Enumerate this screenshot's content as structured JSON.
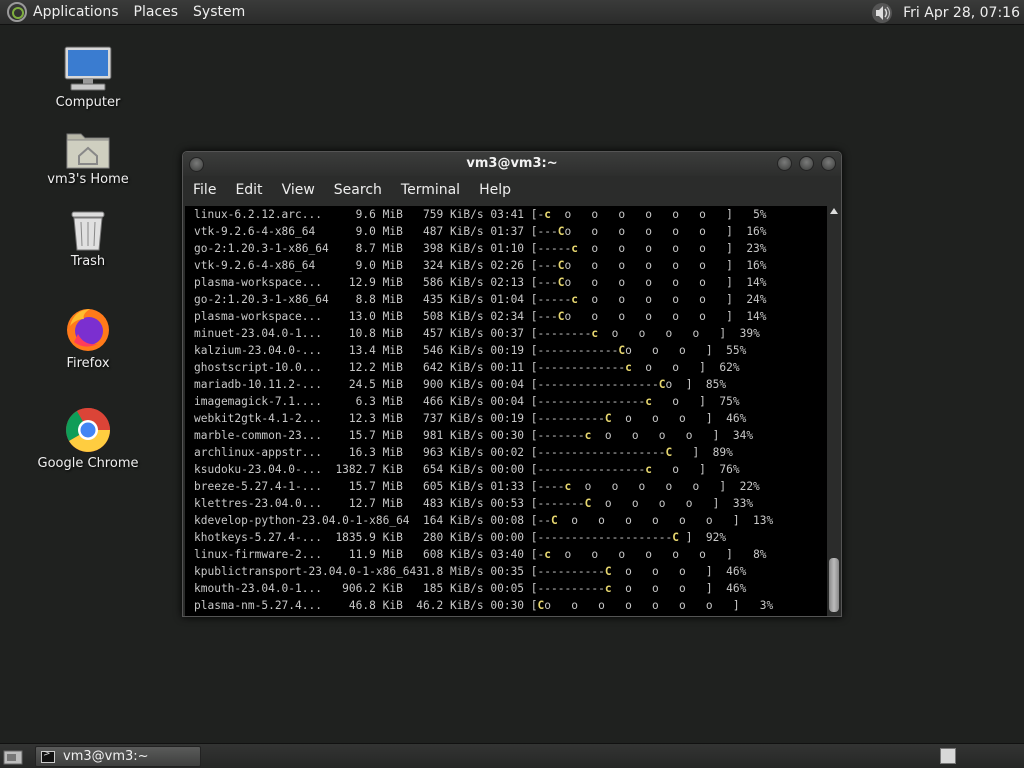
{
  "top_panel": {
    "menus": [
      "Applications",
      "Places",
      "System"
    ],
    "clock": "Fri Apr 28, 07:16"
  },
  "desktop_icons": [
    {
      "label": "Computer"
    },
    {
      "label": "vm3's Home"
    },
    {
      "label": "Trash"
    },
    {
      "label": "Firefox"
    },
    {
      "label": "Google Chrome"
    }
  ],
  "window": {
    "title": "vm3@vm3:~",
    "menu": [
      "File",
      "Edit",
      "View",
      "Search",
      "Terminal",
      "Help"
    ],
    "lines": [
      {
        "pre": "linux-6.2.12.arc...     9.6 MiB   759 KiB/s 03:41 [-",
        "pac": "c",
        "post": "  o   o   o   o   o   o   ]   5%"
      },
      {
        "pre": "vtk-9.2.6-4-x86_64      9.0 MiB   487 KiB/s 01:37 [---",
        "pac": "C",
        "post": "o   o   o   o   o   o   ]  16%"
      },
      {
        "pre": "go-2:1.20.3-1-x86_64    8.7 MiB   398 KiB/s 01:10 [-----",
        "pac": "c",
        "post": "  o   o   o   o   o   ]  23%"
      },
      {
        "pre": "vtk-9.2.6-4-x86_64      9.0 MiB   324 KiB/s 02:26 [---",
        "pac": "C",
        "post": "o   o   o   o   o   o   ]  16%"
      },
      {
        "pre": "plasma-workspace...    12.9 MiB   586 KiB/s 02:13 [---",
        "pac": "C",
        "post": "o   o   o   o   o   o   ]  14%"
      },
      {
        "pre": "go-2:1.20.3-1-x86_64    8.8 MiB   435 KiB/s 01:04 [-----",
        "pac": "c",
        "post": "  o   o   o   o   o   ]  24%"
      },
      {
        "pre": "plasma-workspace...    13.0 MiB   508 KiB/s 02:34 [---",
        "pac": "C",
        "post": "o   o   o   o   o   o   ]  14%"
      },
      {
        "pre": "minuet-23.04.0-1...    10.8 MiB   457 KiB/s 00:37 [--------",
        "pac": "c",
        "post": "  o   o   o   o   ]  39%"
      },
      {
        "pre": "kalzium-23.04.0-...    13.4 MiB   546 KiB/s 00:19 [------------",
        "pac": "C",
        "post": "o   o   o   ]  55%"
      },
      {
        "pre": "ghostscript-10.0...    12.2 MiB   642 KiB/s 00:11 [-------------",
        "pac": "c",
        "post": "  o   o   ]  62%"
      },
      {
        "pre": "mariadb-10.11.2-...    24.5 MiB   900 KiB/s 00:04 [------------------",
        "pac": "C",
        "post": "o  ]  85%"
      },
      {
        "pre": "imagemagick-7.1....     6.3 MiB   466 KiB/s 00:04 [----------------",
        "pac": "c",
        "post": "   o   ]  75%"
      },
      {
        "pre": "webkit2gtk-4.1-2...    12.3 MiB   737 KiB/s 00:19 [----------",
        "pac": "C",
        "post": "  o   o   o   ]  46%"
      },
      {
        "pre": "marble-common-23...    15.7 MiB   981 KiB/s 00:30 [-------",
        "pac": "c",
        "post": "  o   o   o   o   ]  34%"
      },
      {
        "pre": "archlinux-appstr...    16.3 MiB   963 KiB/s 00:02 [-------------------",
        "pac": "C",
        "post": "   ]  89%"
      },
      {
        "pre": "ksudoku-23.04.0-...  1382.7 KiB   654 KiB/s 00:00 [----------------",
        "pac": "c",
        "post": "   o   ]  76%"
      },
      {
        "pre": "breeze-5.27.4-1-...    15.7 MiB   605 KiB/s 01:33 [----",
        "pac": "c",
        "post": "  o   o   o   o   o   ]  22%"
      },
      {
        "pre": "klettres-23.04.0...    12.7 MiB   483 KiB/s 00:53 [-------",
        "pac": "C",
        "post": "  o   o   o   o   ]  33%"
      },
      {
        "pre": "kdevelop-python-23.04.0-1-x86_64  164 KiB/s 00:08 [--",
        "pac": "C",
        "post": "  o   o   o   o   o   o   ]  13%"
      },
      {
        "pre": "khotkeys-5.27.4-...  1835.9 KiB   280 KiB/s 00:00 [--------------------",
        "pac": "C",
        "post": " ]  92%"
      },
      {
        "pre": "linux-firmware-2...    11.9 MiB   608 KiB/s 03:40 [-",
        "pac": "c",
        "post": "  o   o   o   o   o   o   ]   8%"
      },
      {
        "pre": "kpublictransport-23.04.0-1-x86_6431.8 MiB/s 00:35 [----------",
        "pac": "C",
        "post": "  o   o   o   ]  46%"
      },
      {
        "pre": "kmouth-23.04.0-1...   906.2 KiB   185 KiB/s 00:05 [----------",
        "pac": "c",
        "post": "  o   o   o   ]  46%"
      },
      {
        "pre": "plasma-nm-5.27.4...    46.8 KiB  46.2 KiB/s 00:30 [",
        "pac": "C",
        "post": "o   o   o   o   o   o   o   ]   3%"
      }
    ]
  },
  "bottom_panel": {
    "task_label": "vm3@vm3:~"
  }
}
